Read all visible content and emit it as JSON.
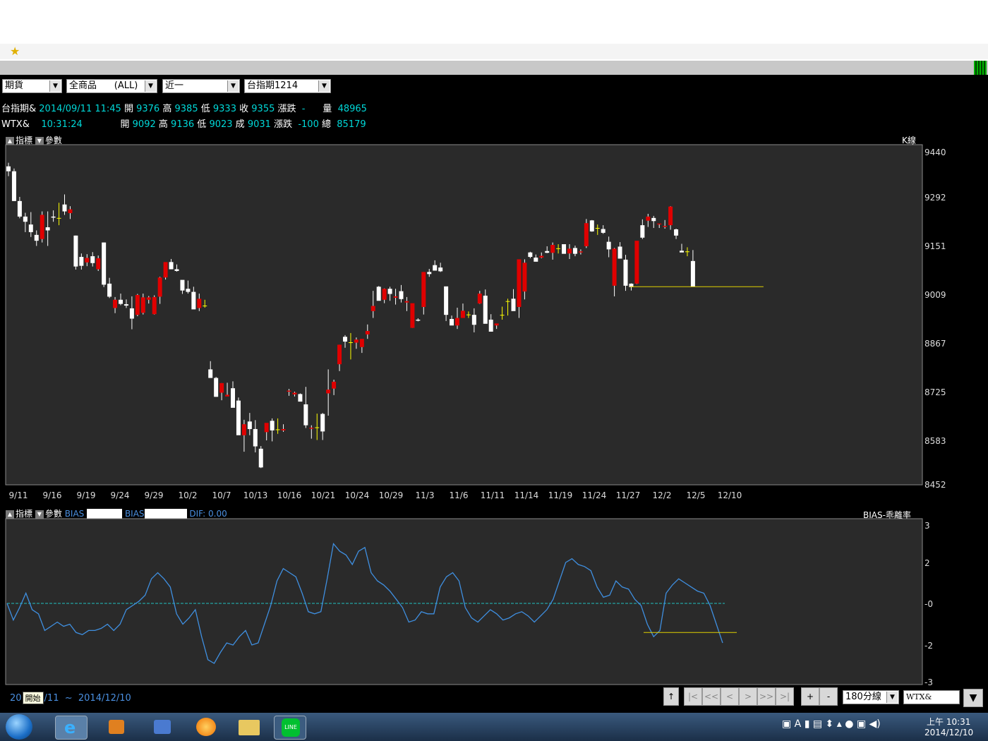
{
  "favorites": {
    "star_icon": "star-icon"
  },
  "toolbar": {
    "market": "期貨",
    "product": "全商品      (ALL)",
    "period": "近一",
    "contract": "台指期1214"
  },
  "quote1": {
    "name": "台指期&",
    "datetime": "2014/09/11 11:45",
    "open_label": "開",
    "open": "9376",
    "high_label": "高",
    "high": "9385",
    "low_label": "低",
    "low": "9333",
    "close_label": "收",
    "close": "9355",
    "chg_label": "漲跌",
    "chg": "-",
    "vol_label": "量",
    "vol": "48965"
  },
  "quote2": {
    "name": "WTX&",
    "time": "10:31:24",
    "open_label": "開",
    "open": "9092",
    "high_label": "高",
    "high": "9136",
    "low_label": "低",
    "low": "9023",
    "last_label": "成",
    "last": "9031",
    "chg_label": "漲跌",
    "chg": "-100",
    "total_label": "總",
    "total": "85179"
  },
  "main_panel": {
    "indicator_label": "指標",
    "param_label": "參數",
    "type_label": "K線"
  },
  "sub_panel": {
    "indicator_label": "指標",
    "param_label": "參數",
    "bias1_label": "BIAS",
    "bias2_label": "BIAS",
    "dif_label": "DIF:",
    "dif_value": "0.00",
    "type_label": "BIAS-乖離率"
  },
  "footer": {
    "range_start": "20",
    "start_tooltip": "開始",
    "range_rest": "/11  ~  2014/12/10"
  },
  "nav": {
    "up": "↑",
    "first": "|<",
    "prev_page": "<<",
    "prev": "<",
    "next": ">",
    "next_page": ">>",
    "last": ">|",
    "zoom_in": "+",
    "zoom_out": "-",
    "interval": "180分線",
    "symbol": "WTX&"
  },
  "tray": {
    "time": "上午 10:31",
    "date": "2014/12/10"
  },
  "colors": {
    "up": "#e00000",
    "down": "#ffffff",
    "doji": "#ffff00",
    "bias_line": "#3f8fe0",
    "zero_line": "#20c0c0",
    "support": "#e0d000"
  },
  "chart_data": [
    {
      "type": "candlestick",
      "x_tick_labels": [
        "9/11",
        "9/16",
        "9/19",
        "9/24",
        "9/29",
        "10/2",
        "10/7",
        "10/13",
        "10/16",
        "10/21",
        "10/24",
        "10/29",
        "11/3",
        "11/6",
        "11/11",
        "11/14",
        "11/19",
        "11/24",
        "11/27",
        "12/2",
        "12/5",
        "12/10"
      ],
      "y_tick_labels": [
        "9440",
        "9292",
        "9151",
        "9009",
        "8867",
        "8725",
        "8583",
        "8452"
      ],
      "ylim": [
        8452,
        9440
      ],
      "support_line": 9031,
      "ohlc": [
        [
          9392,
          9404,
          9360,
          9376
        ],
        [
          9376,
          9385,
          9280,
          9280
        ],
        [
          9280,
          9292,
          9230,
          9235
        ],
        [
          9235,
          9246,
          9190,
          9220
        ],
        [
          9212,
          9248,
          9176,
          9190
        ],
        [
          9182,
          9195,
          9150,
          9165
        ],
        [
          9170,
          9250,
          9160,
          9240
        ],
        [
          9204,
          9250,
          9150,
          9195
        ],
        [
          9235,
          9253,
          9220,
          9232
        ],
        [
          9230,
          9275,
          9210,
          9230
        ],
        [
          9270,
          9300,
          9240,
          9250
        ],
        [
          9245,
          9265,
          9228,
          9256
        ],
        [
          9180,
          9180,
          9081,
          9090
        ],
        [
          9118,
          9128,
          9081,
          9092
        ],
        [
          9102,
          9126,
          9091,
          9115
        ],
        [
          9120,
          9132,
          9090,
          9100
        ],
        [
          9082,
          9122,
          9077,
          9114
        ],
        [
          9160,
          9160,
          9030,
          9037
        ],
        [
          9040,
          9057,
          8998,
          9002
        ],
        [
          8969,
          9001,
          8954,
          8993
        ],
        [
          8993,
          9011,
          8977,
          8981
        ],
        [
          8980,
          8994,
          8969,
          8976
        ],
        [
          8968,
          9003,
          8907,
          8938
        ],
        [
          8949,
          9010,
          8945,
          9007
        ],
        [
          8955,
          9011,
          8950,
          9000
        ],
        [
          8993,
          9004,
          8982,
          9000
        ],
        [
          8951,
          9006,
          8950,
          9001
        ],
        [
          9002,
          9060,
          8981,
          9058
        ],
        [
          9058,
          9102,
          9052,
          9103
        ],
        [
          9103,
          9112,
          9082,
          9082
        ],
        [
          9082,
          9096,
          9075,
          9077
        ],
        [
          9051,
          9050,
          9010,
          9020
        ],
        [
          9025,
          9049,
          9011,
          9016
        ],
        [
          9016,
          9031,
          8995,
          8965
        ],
        [
          8969,
          9011,
          8960,
          8996
        ],
        [
          8977,
          8993,
          8970,
          8975
        ],
        [
          8790,
          8814,
          8765,
          8765
        ],
        [
          8765,
          8768,
          8710,
          8710
        ],
        [
          8722,
          8750,
          8700,
          8750
        ],
        [
          8711,
          8751,
          8715,
          8716
        ],
        [
          8735,
          8755,
          8685,
          8678
        ],
        [
          8699,
          8708,
          8605,
          8598
        ],
        [
          8598,
          8643,
          8549,
          8630
        ],
        [
          8638,
          8663,
          8598,
          8616
        ],
        [
          8616,
          8642,
          8547,
          8565
        ],
        [
          8558,
          8566,
          8500,
          8502
        ],
        [
          8607,
          8624,
          8583,
          8634
        ],
        [
          8640,
          8647,
          8580,
          8612
        ],
        [
          8614,
          8647,
          8602,
          8614
        ],
        [
          8612,
          8630,
          8608,
          8616
        ],
        [
          8725,
          8733,
          8713,
          8728
        ],
        [
          8717,
          8725,
          8711,
          8722
        ],
        [
          8718,
          8720,
          8699,
          8696
        ],
        [
          8688,
          8739,
          8619,
          8627
        ],
        [
          8617,
          8627,
          8588,
          8620
        ],
        [
          8621,
          8661,
          8584,
          8620
        ],
        [
          8660,
          8663,
          8584,
          8609
        ],
        [
          8720,
          8790,
          8655,
          8731
        ],
        [
          8734,
          8760,
          8715,
          8754
        ],
        [
          8805,
          8862,
          8785,
          8862
        ],
        [
          8885,
          8890,
          8853,
          8871
        ],
        [
          8869,
          8896,
          8819,
          8868
        ],
        [
          8868,
          8883,
          8850,
          8877
        ],
        [
          8855,
          8870,
          8838,
          8879
        ],
        [
          8892,
          8921,
          8879,
          8902
        ],
        [
          8960,
          9019,
          8940,
          8975
        ],
        [
          9031,
          9033,
          8993,
          8990
        ],
        [
          8993,
          9026,
          8983,
          9025
        ],
        [
          9025,
          9031,
          8990,
          9010
        ],
        [
          8999,
          9025,
          8979,
          9003
        ],
        [
          9018,
          9036,
          8985,
          8995
        ],
        [
          8985,
          9001,
          8960,
          8989
        ],
        [
          8911,
          8960,
          8911,
          8983
        ],
        [
          8935,
          8939,
          8930,
          8932
        ],
        [
          8972,
          9074,
          8950,
          9074
        ],
        [
          9074,
          9083,
          9060,
          9068
        ],
        [
          9094,
          9108,
          9082,
          9078
        ],
        [
          9087,
          9101,
          9074,
          9076
        ],
        [
          9032,
          9031,
          8931,
          8949
        ],
        [
          8937,
          8947,
          8920,
          8918
        ],
        [
          8918,
          8970,
          8908,
          8940
        ],
        [
          8940,
          8982,
          8945,
          8961
        ],
        [
          8951,
          8959,
          8940,
          8949
        ],
        [
          8949,
          8968,
          8898,
          8920
        ],
        [
          8982,
          9019,
          8981,
          9011
        ],
        [
          9005,
          9023,
          8964,
          8923
        ],
        [
          8935,
          8951,
          8907,
          8900
        ],
        [
          8918,
          8923,
          8908,
          8924
        ],
        [
          8949,
          8973,
          8935,
          8948
        ],
        [
          8988,
          8996,
          8947,
          8988
        ],
        [
          8996,
          9024,
          8972,
          8960
        ],
        [
          8972,
          9110,
          8940,
          9111
        ],
        [
          9017,
          9111,
          8994,
          9101
        ],
        [
          9131,
          9133,
          9114,
          9118
        ],
        [
          9116,
          9125,
          9105,
          9104
        ],
        [
          9116,
          9131,
          9114,
          9121
        ],
        [
          9135,
          9149,
          9129,
          9130
        ],
        [
          9130,
          9160,
          9110,
          9153
        ],
        [
          9141,
          9155,
          9128,
          9142
        ],
        [
          9155,
          9154,
          9128,
          9127
        ],
        [
          9128,
          9155,
          9112,
          9142
        ],
        [
          9144,
          9151,
          9120,
          9127
        ],
        [
          9131,
          9140,
          9125,
          9134
        ],
        [
          9149,
          9228,
          9144,
          9216
        ],
        [
          9224,
          9225,
          9191,
          9192
        ],
        [
          9202,
          9212,
          9182,
          9201
        ],
        [
          9199,
          9210,
          9185,
          9188
        ],
        [
          9162,
          9177,
          9117,
          9140
        ],
        [
          9034,
          9144,
          9003,
          9142
        ],
        [
          9148,
          9161,
          9140,
          9113
        ],
        [
          9110,
          9124,
          9019,
          9034
        ],
        [
          9040,
          9041,
          9020,
          9030
        ],
        [
          9040,
          9156,
          9039,
          9165
        ],
        [
          9210,
          9227,
          9170,
          9174
        ],
        [
          9223,
          9243,
          9205,
          9235
        ],
        [
          9231,
          9237,
          9202,
          9222
        ],
        [
          9212,
          9213,
          9202,
          9215
        ],
        [
          9205,
          9225,
          9200,
          9208
        ],
        [
          9210,
          9265,
          9197,
          9264
        ],
        [
          9198,
          9200,
          9170,
          9180
        ],
        [
          9136,
          9156,
          9132,
          9131
        ],
        [
          9132,
          9146,
          9120,
          9133
        ],
        [
          9106,
          9138,
          9032,
          9031
        ]
      ]
    },
    {
      "type": "line",
      "name": "BIAS",
      "y_tick_labels": [
        "3",
        "2",
        "-0",
        "-2",
        "-3"
      ],
      "ylim": [
        -3,
        3
      ],
      "reference_line": 0,
      "support_line": -1.4,
      "values": [
        0,
        -0.8,
        -0.2,
        0.5,
        -0.3,
        -0.5,
        -1.3,
        -1.1,
        -0.9,
        -1.1,
        -1.0,
        -1.4,
        -1.5,
        -1.3,
        -1.3,
        -1.2,
        -1.0,
        -1.3,
        -1.0,
        -0.3,
        -0.1,
        0.1,
        0.4,
        1.2,
        1.5,
        1.2,
        0.8,
        -0.5,
        -1.0,
        -0.7,
        -0.3,
        -1.6,
        -2.4,
        -2.5,
        -2.2,
        -1.9,
        -2.0,
        -1.6,
        -1.3,
        -2.0,
        -1.9,
        -1.0,
        -0.1,
        1.1,
        1.7,
        1.5,
        1.3,
        0.5,
        -0.4,
        -0.5,
        -0.4,
        1.2,
        2.5,
        2.3,
        2.2,
        1.9,
        2.3,
        2.4,
        1.5,
        1.1,
        0.9,
        0.6,
        0.2,
        -0.2,
        -0.9,
        -0.8,
        -0.4,
        -0.5,
        -0.5,
        0.8,
        1.3,
        1.5,
        1.1,
        -0.2,
        -0.7,
        -0.9,
        -0.6,
        -0.3,
        -0.5,
        -0.8,
        -0.7,
        -0.5,
        -0.4,
        -0.6,
        -0.9,
        -0.6,
        -0.3,
        0.2,
        1.1,
        2.0,
        2.1,
        1.9,
        1.8,
        1.6,
        0.8,
        0.3,
        0.4,
        1.1,
        0.8,
        0.7,
        0.2,
        -0.1,
        -1.0,
        -1.6,
        -1.3,
        0.5,
        0.9,
        1.2,
        1.0,
        0.8,
        0.6,
        0.5,
        -0.1,
        -1.0,
        -1.9
      ]
    }
  ]
}
